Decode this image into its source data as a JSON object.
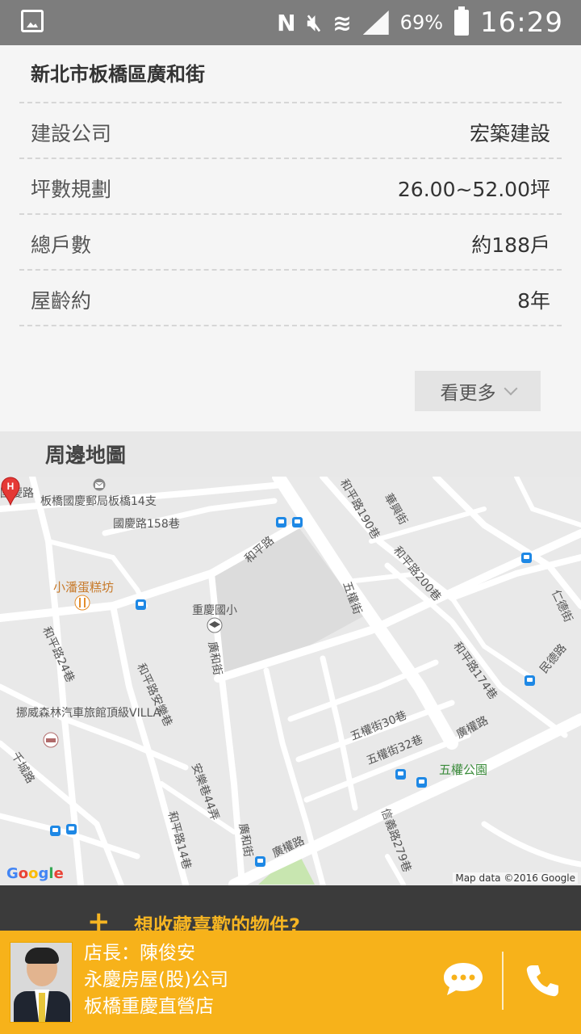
{
  "status_bar": {
    "battery_percent": "69%",
    "time": "16:29",
    "icons": [
      "gallery-notification-icon",
      "nfc-icon",
      "mute-icon",
      "wifi-icon",
      "signal-icon",
      "battery-charging-icon"
    ]
  },
  "property": {
    "address": "新北市板橋區廣和街",
    "details": [
      {
        "label": "建設公司",
        "value": "宏築建設"
      },
      {
        "label": "坪數規劃",
        "value": "26.00~52.00坪"
      },
      {
        "label": "總戶數",
        "value": "約188戶"
      },
      {
        "label": "屋齡約",
        "value": "8年"
      }
    ],
    "more_label": "看更多"
  },
  "map": {
    "title": "周邊地圖",
    "labels": {
      "guoqing_rd": "國慶路",
      "post_office": "板橋國慶郵局板橋14支",
      "guoqing_158": "國慶路158巷",
      "heping_190": "和平路190巷",
      "huasheng": "華興街",
      "heping_rd": "和平路",
      "heping_200": "和平路200巷",
      "bakery": "小潘蛋糕坊",
      "school": "重慶國小",
      "wuquan_st": "五權街",
      "heping_24": "和平路24巷",
      "guanghe_st": "廣和街",
      "heping_anle": "和平路安樂巷",
      "heping_174": "和平路174巷",
      "minde": "民德路",
      "hotel": "挪威森林汽車旅館頂級VILLA",
      "wuquan_30": "五權街30巷",
      "guangquan": "廣權路",
      "wuquan_32": "五權街32巷",
      "wuquan_park": "五權公園",
      "qianjin": "千城路",
      "anle_44": "安樂巷44弄",
      "heping_14": "和平路14巷",
      "guanghe_st2": "廣和街",
      "guangquan2": "廣權路",
      "xinyi": "信義路279巷",
      "rende": "仁德街"
    },
    "google_logo": [
      "G",
      "o",
      "o",
      "g",
      "l",
      "e"
    ],
    "attribution": "Map data ©2016 Google"
  },
  "promo": {
    "plus": "+",
    "text": "想收藏喜歡的物件?"
  },
  "agent": {
    "title_line": "店長：陳俊安",
    "company": "永慶房屋(股)公司",
    "branch": "板橋重慶直營店"
  },
  "colors": {
    "accent": "#f7b21a",
    "promo_bg": "#3b3b3b",
    "promo_text": "#f6b522",
    "status_bar": "#7d7d7d"
  }
}
